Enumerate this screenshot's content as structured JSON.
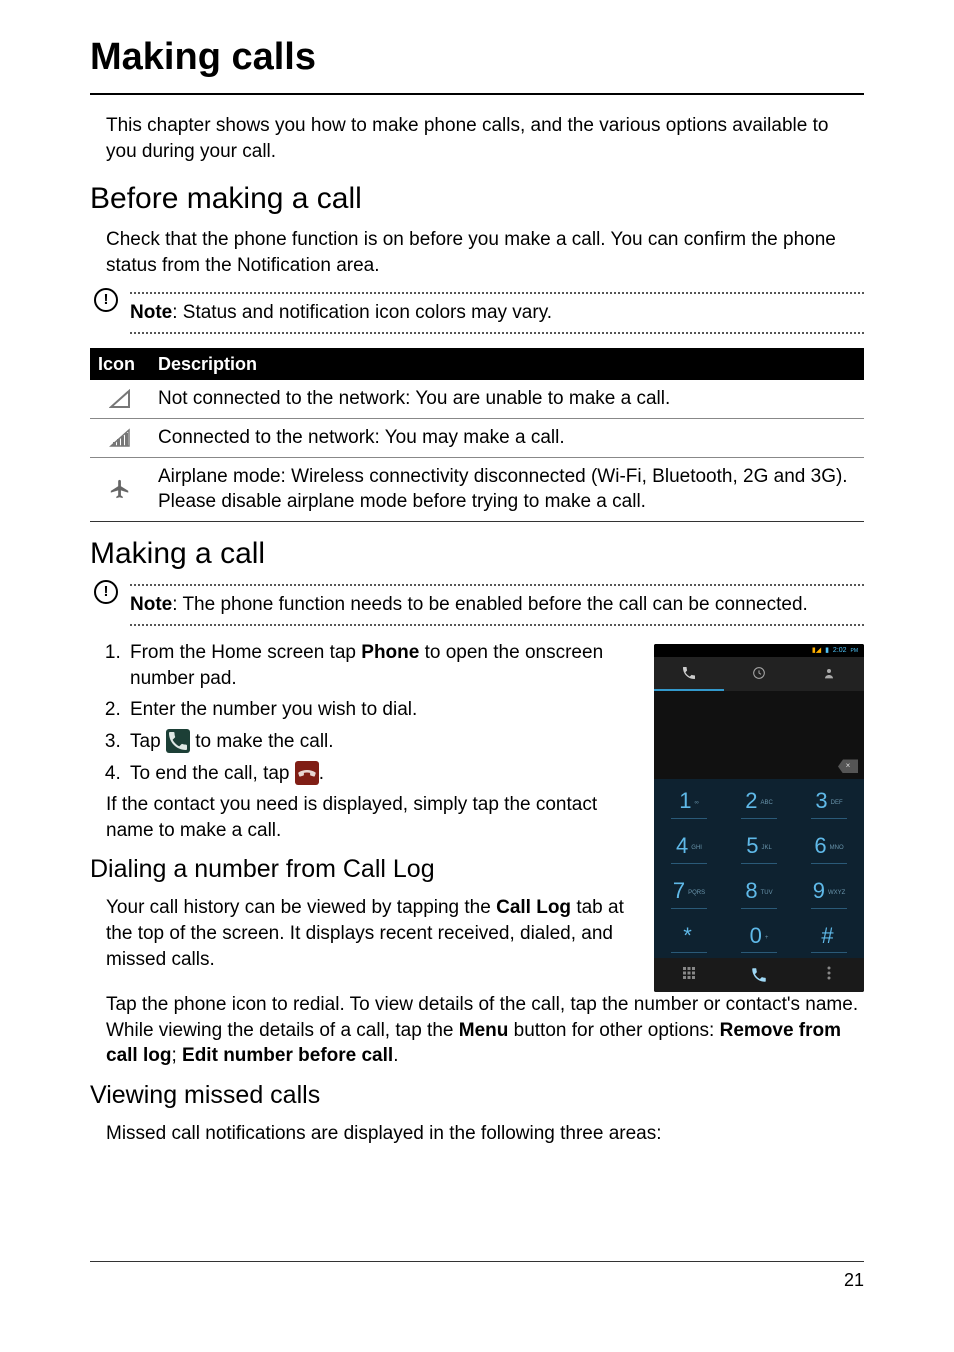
{
  "page": {
    "title": "Making calls",
    "intro": "This chapter shows you how to make phone calls, and the various options available to you during your call.",
    "number": "21"
  },
  "before": {
    "heading": "Before making a call",
    "text": "Check that the phone function is on before you make a call. You can confirm the phone status from the Notification area.",
    "note_label": "Note",
    "note_text": ": Status and notification icon colors may vary."
  },
  "table": {
    "col_icon": "Icon",
    "col_desc": "Description",
    "rows": [
      {
        "desc": "Not connected to the network: You are unable to make a call."
      },
      {
        "desc": "Connected to the network: You may make a call."
      },
      {
        "desc": "Airplane mode: Wireless connectivity disconnected (Wi-Fi, Bluetooth, 2G and 3G). Please disable airplane mode before trying to make a call."
      }
    ]
  },
  "making": {
    "heading": "Making a call",
    "note_label": "Note",
    "note_text": ": The phone function needs to be enabled before the call can be connected.",
    "step1_a": "From the Home screen tap ",
    "step1_b": "Phone",
    "step1_c": " to open the onscreen number pad.",
    "step2": "Enter the number you wish to dial.",
    "step3_a": "Tap ",
    "step3_b": " to make the call.",
    "step4_a": "To end the call, tap ",
    "step4_b": ".",
    "contact_text": "If the contact you need is displayed, simply tap the contact name to make a call."
  },
  "calllog": {
    "heading": "Dialing a number from Call Log",
    "p1_a": "Your call history can be viewed by tapping the ",
    "p1_b": "Call Log",
    "p1_c": " tab at the top of the screen. It displays recent received, dialed, and missed calls.",
    "p2_a": "Tap the phone icon to redial. To view details of the call, tap the number or contact's name. While viewing the details of a call, tap the ",
    "p2_b": "Menu",
    "p2_c": " button for other options: ",
    "p2_d": "Remove from call log",
    "p2_e": "; ",
    "p2_f": "Edit number before call",
    "p2_g": "."
  },
  "missed": {
    "heading": "Viewing missed calls",
    "text": "Missed call notifications are displayed in the following three areas:"
  },
  "phone_mock": {
    "time": "2:02",
    "pm": "PM",
    "keys": [
      {
        "d": "1",
        "l": "∞"
      },
      {
        "d": "2",
        "l": "ABC"
      },
      {
        "d": "3",
        "l": "DEF"
      },
      {
        "d": "4",
        "l": "GHI"
      },
      {
        "d": "5",
        "l": "JKL"
      },
      {
        "d": "6",
        "l": "MNO"
      },
      {
        "d": "7",
        "l": "PQRS"
      },
      {
        "d": "8",
        "l": "TUV"
      },
      {
        "d": "9",
        "l": "WXYZ"
      },
      {
        "d": "*",
        "l": ""
      },
      {
        "d": "0",
        "l": "+"
      },
      {
        "d": "#",
        "l": ""
      }
    ]
  }
}
